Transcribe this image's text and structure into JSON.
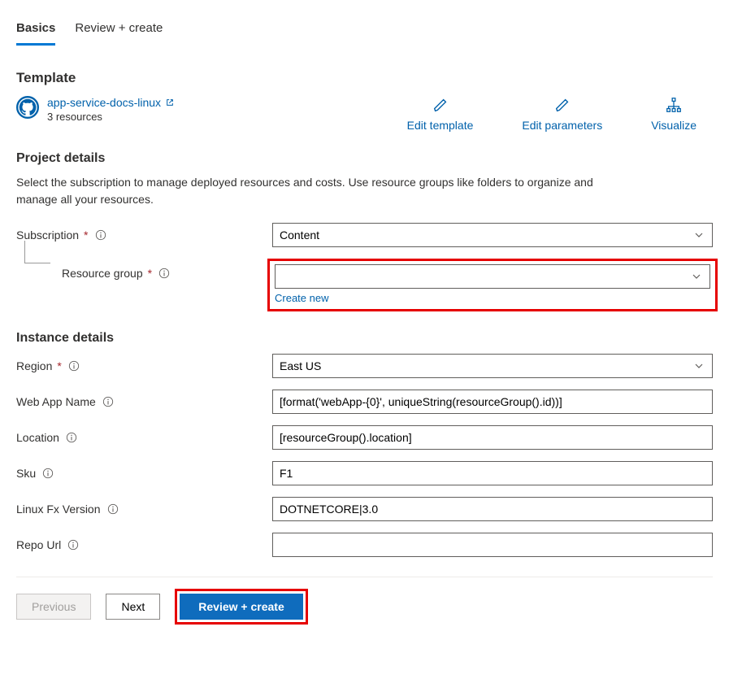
{
  "tabs": {
    "basics": "Basics",
    "review": "Review + create"
  },
  "template": {
    "heading": "Template",
    "link_text": "app-service-docs-linux",
    "resources": "3 resources",
    "actions": {
      "edit_template": "Edit template",
      "edit_parameters": "Edit parameters",
      "visualize": "Visualize"
    }
  },
  "project": {
    "heading": "Project details",
    "desc": "Select the subscription to manage deployed resources and costs. Use resource groups like folders to organize and manage all your resources.",
    "subscription_label": "Subscription",
    "subscription_value": "Content",
    "resource_group_label": "Resource group",
    "resource_group_value": "",
    "create_new": "Create new"
  },
  "instance": {
    "heading": "Instance details",
    "region_label": "Region",
    "region_value": "East US",
    "webapp_label": "Web App Name",
    "webapp_value": "[format('webApp-{0}', uniqueString(resourceGroup().id))]",
    "location_label": "Location",
    "location_value": "[resourceGroup().location]",
    "sku_label": "Sku",
    "sku_value": "F1",
    "linux_label": "Linux Fx Version",
    "linux_value": "DOTNETCORE|3.0",
    "repo_label": "Repo Url",
    "repo_value": ""
  },
  "footer": {
    "previous": "Previous",
    "next": "Next",
    "review": "Review + create"
  }
}
